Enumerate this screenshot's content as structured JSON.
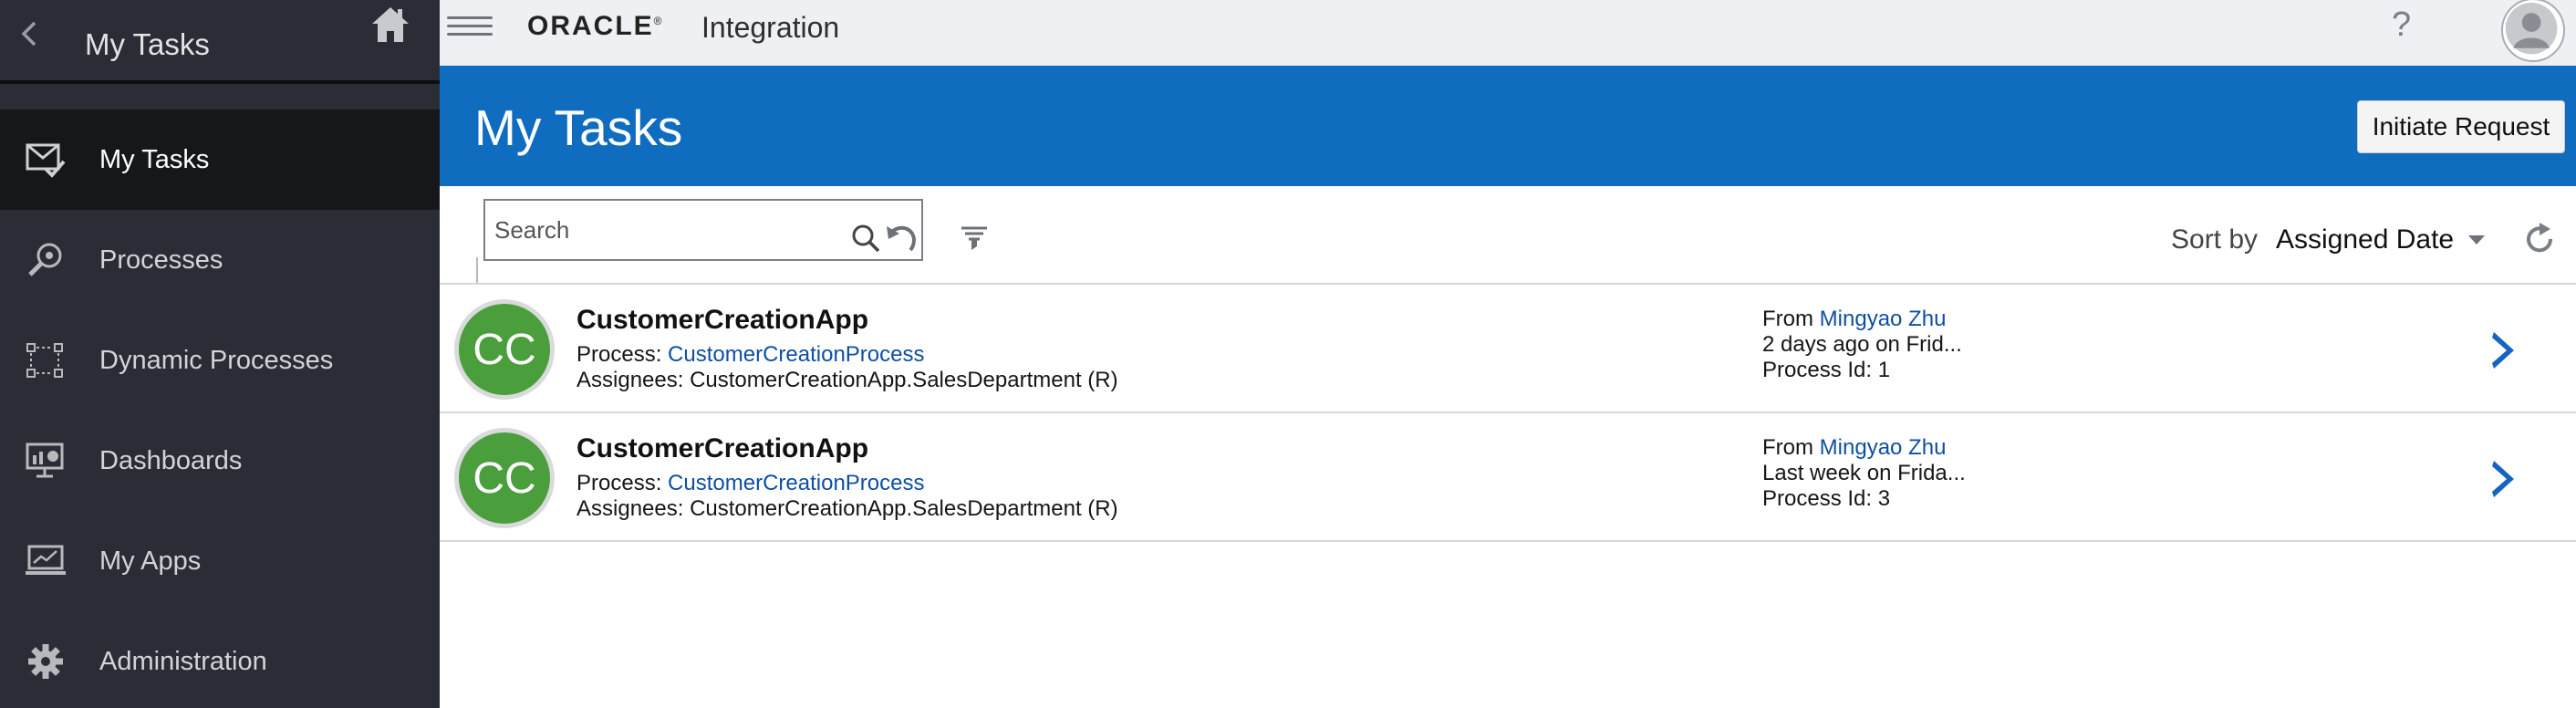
{
  "sidebar": {
    "title": "My Tasks",
    "items": [
      {
        "label": "My Tasks",
        "icon": "tasks-icon",
        "active": true
      },
      {
        "label": "Processes",
        "icon": "processes-icon"
      },
      {
        "label": "Dynamic Processes",
        "icon": "dynamic-processes-icon"
      },
      {
        "label": "Dashboards",
        "icon": "dashboard-icon"
      },
      {
        "label": "My Apps",
        "icon": "apps-icon"
      },
      {
        "label": "Administration",
        "icon": "gear-icon"
      }
    ]
  },
  "topbar": {
    "brand": "ORACLE",
    "brand_mark": "®",
    "product": "Integration",
    "help": "?"
  },
  "header": {
    "title": "My Tasks",
    "initiate_label": "Initiate Request"
  },
  "toolbar": {
    "search_placeholder": "Search",
    "sort_label": "Sort by",
    "sort_value": "Assigned Date"
  },
  "tasks": [
    {
      "initials": "CC",
      "name": "CustomerCreationApp",
      "process_label": "Process:",
      "process": "CustomerCreationProcess",
      "assignees": "Assignees: CustomerCreationApp.SalesDepartment (R)",
      "from_label": "From",
      "from": "Mingyao Zhu",
      "when": "2 days ago on Frid...",
      "process_id": "Process Id: 1"
    },
    {
      "initials": "CC",
      "name": "CustomerCreationApp",
      "process_label": "Process:",
      "process": "CustomerCreationProcess",
      "assignees": "Assignees: CustomerCreationApp.SalesDepartment (R)",
      "from_label": "From",
      "from": "Mingyao Zhu",
      "when": "Last week on Frida...",
      "process_id": "Process Id: 3"
    }
  ],
  "colors": {
    "sidebar_bg": "#2b2d36",
    "header_blue": "#0f6cbf",
    "avatar_green": "#4b9e3c",
    "link_blue": "#0e4fa2"
  }
}
